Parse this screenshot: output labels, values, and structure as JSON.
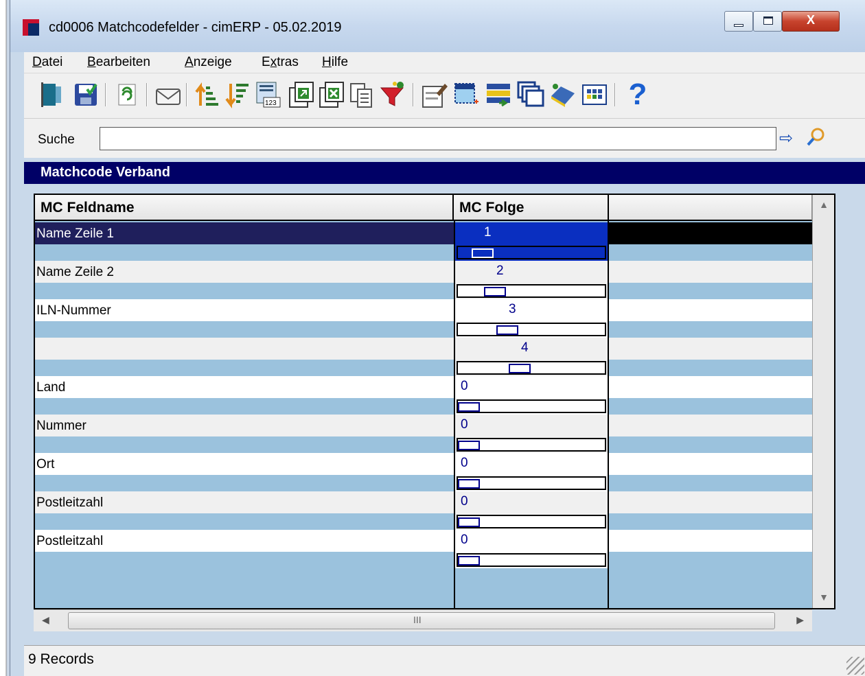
{
  "window": {
    "title": "cd0006 Matchcodefelder - cimERP - 05.02.2019",
    "controls": {
      "minimize": "minimize-icon",
      "maximize": "maximize-icon",
      "close": "X"
    }
  },
  "menu": {
    "items": [
      {
        "label": "Datei",
        "u": "D",
        "rest": "atei"
      },
      {
        "label": "Bearbeiten",
        "u": "B",
        "rest": "earbeiten"
      },
      {
        "label": "Anzeige",
        "u": "A",
        "rest": "nzeige"
      },
      {
        "label": "Extras",
        "pre": "E",
        "u": "x",
        "rest": "tras"
      },
      {
        "label": "Hilfe",
        "u": "H",
        "rest": "ilfe"
      }
    ]
  },
  "toolbar": {
    "icons": [
      "exit-icon",
      "save-icon",
      "refresh-icon",
      "email-icon",
      "sort-ascending-icon",
      "sort-descending-icon",
      "numbering-icon",
      "export-icon",
      "excel-export-icon",
      "copy-icon",
      "filter-icon",
      "edit-icon",
      "select-area-icon",
      "transfer-icon",
      "windows-icon",
      "book-icon",
      "grid-view-icon",
      "help-icon"
    ]
  },
  "search": {
    "label": "Suche",
    "value": ""
  },
  "section": {
    "title": "Matchcode Verband"
  },
  "grid": {
    "columns": [
      "MC Feldname",
      "MC Folge",
      ""
    ],
    "rows": [
      {
        "name": "Name Zeile 1",
        "folge": "1",
        "level": 1,
        "selected": true
      },
      {
        "name": "Name Zeile 2",
        "folge": "2",
        "level": 2,
        "selected": false
      },
      {
        "name": "ILN-Nummer",
        "folge": "3",
        "level": 3,
        "selected": false
      },
      {
        "name": "",
        "folge": "4",
        "level": 4,
        "selected": false
      },
      {
        "name": "Land",
        "folge": "0",
        "level": 0,
        "selected": false
      },
      {
        "name": "Nummer",
        "folge": "0",
        "level": 0,
        "selected": false
      },
      {
        "name": "Ort",
        "folge": "0",
        "level": 0,
        "selected": false
      },
      {
        "name": "Postleitzahl",
        "folge": "0",
        "level": 0,
        "selected": false
      },
      {
        "name": "Postleitzahl",
        "folge": "0",
        "level": 0,
        "selected": false
      }
    ],
    "hscroll_grip": "III"
  },
  "status": {
    "records": "9 Records"
  }
}
